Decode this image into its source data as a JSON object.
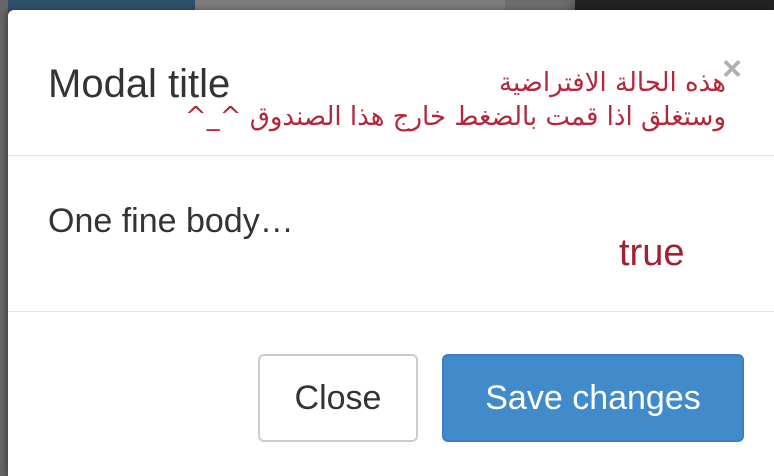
{
  "modal": {
    "title": "Modal title",
    "close_icon": "×",
    "note_line1": "هذه الحالة الافتراضية",
    "note_line2": "وستغلق اذا قمت بالضغط خارج هذا الصندوق ^_^",
    "body_text": "One fine body…",
    "backdrop_value": "true",
    "buttons": {
      "close_label": "Close",
      "save_label": "Save changes"
    }
  },
  "colors": {
    "primary": "#428bca",
    "note": "#b5263a",
    "true_text": "#a31f34"
  }
}
